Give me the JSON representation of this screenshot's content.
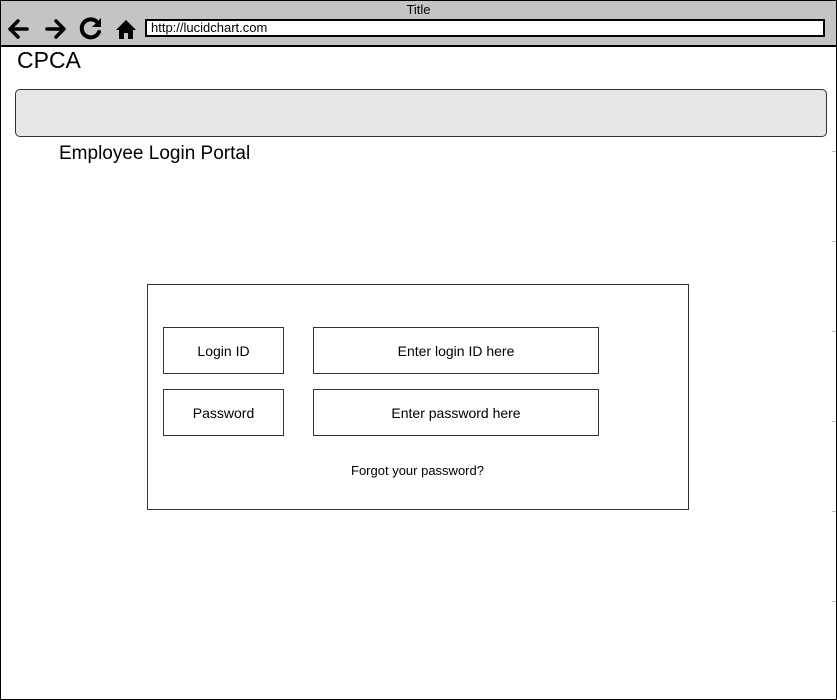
{
  "browser": {
    "window_title": "Title",
    "url": "http://lucidchart.com"
  },
  "page": {
    "brand": "CPCA",
    "title": "Employee Login Portal"
  },
  "login_form": {
    "login_id_label": "Login ID",
    "login_id_placeholder": "Enter login ID here",
    "password_label": "Password",
    "password_placeholder": "Enter password here",
    "forgot_password": "Forgot your password?"
  }
}
